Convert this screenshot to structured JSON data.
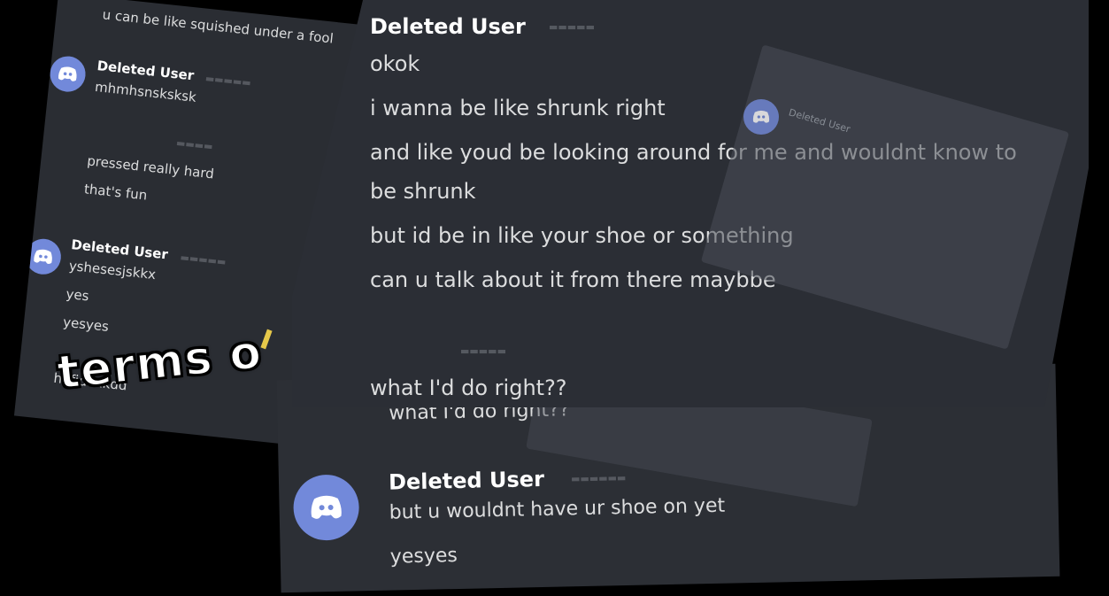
{
  "left_panel": {
    "top_line": "u can be like squished under a fool",
    "user1": "Deleted User",
    "user1_msg": "mhmhsnsksksk",
    "line_pressed": "pressed really hard",
    "line_fun": "that's fun",
    "user2": "Deleted User",
    "user2_msg1": "yshesesjskkx",
    "user2_msg2": "yes",
    "user2_msg3": "yesyes",
    "last_line": "hhfjdkxkdd"
  },
  "caption": "terms o",
  "main_panel": {
    "username": "Deleted User",
    "messages": [
      "okok",
      "i wanna be like shrunk right",
      "and like youd be looking around for me and wouldnt know to",
      "be shrunk",
      "but id be in like your shoe or something",
      "can u talk about it from there maybbe"
    ],
    "after_divider": "what I'd do right??",
    "ghost_username": "Deleted User"
  },
  "bottom_panel": {
    "top_line": "what I'd do right??",
    "username": "Deleted User",
    "msg1": "but u wouldnt have ur shoe on yet",
    "msg2": "yesyes"
  },
  "colors": {
    "background": "#000000",
    "panel": "#2b2e35",
    "text": "#dcddde",
    "username": "#ffffff",
    "avatar": "#7289da",
    "caption": "#ffffff"
  },
  "icons": {
    "avatar": "discord-logo-icon"
  }
}
